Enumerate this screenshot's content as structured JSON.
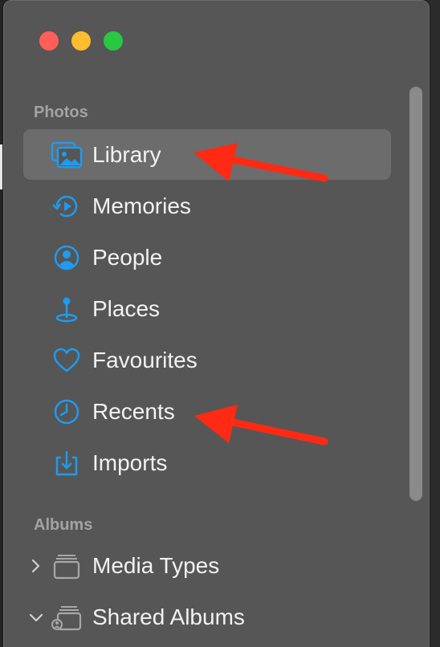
{
  "window": {
    "traffic_lights": [
      "close",
      "minimize",
      "zoom"
    ]
  },
  "sidebar": {
    "photos_header": "Photos",
    "photos_items": [
      {
        "label": "Library",
        "icon": "library-icon",
        "selected": true
      },
      {
        "label": "Memories",
        "icon": "memories-icon"
      },
      {
        "label": "People",
        "icon": "people-icon"
      },
      {
        "label": "Places",
        "icon": "places-icon"
      },
      {
        "label": "Favourites",
        "icon": "heart-icon"
      },
      {
        "label": "Recents",
        "icon": "clock-icon"
      },
      {
        "label": "Imports",
        "icon": "import-icon"
      }
    ],
    "albums_header": "Albums",
    "albums_items": [
      {
        "label": "Media Types",
        "icon": "stack-icon",
        "expanded": false
      },
      {
        "label": "Shared Albums",
        "icon": "shared-stack-icon",
        "expanded": true
      }
    ]
  },
  "annotations": {
    "arrow_color": "#ff2a14",
    "arrows": [
      "points-to-library",
      "points-to-recents"
    ]
  },
  "colors": {
    "accent": "#1e9bf0",
    "sidebar_bg": "#565656",
    "selection_bg": "#6c6c6c"
  }
}
